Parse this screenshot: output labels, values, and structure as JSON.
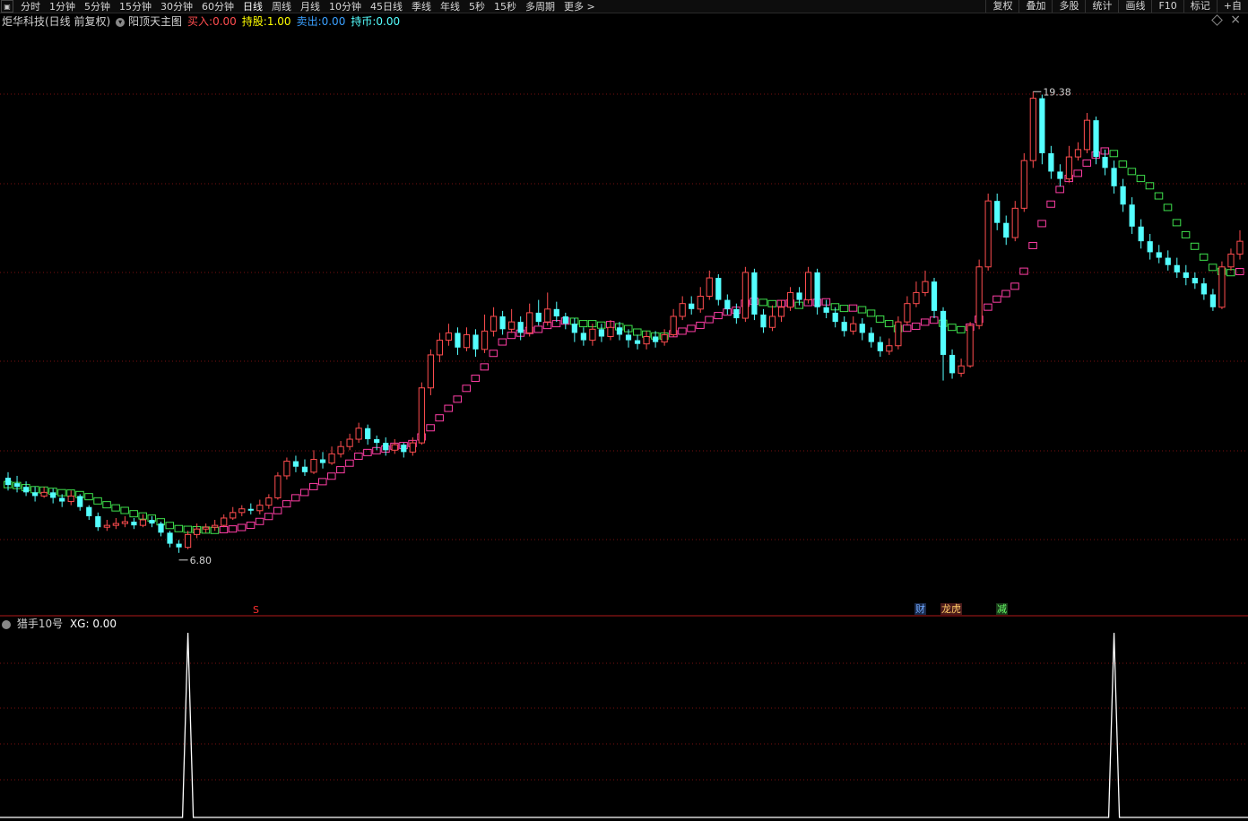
{
  "toolbar": {
    "periods": [
      "分时",
      "1分钟",
      "5分钟",
      "15分钟",
      "30分钟",
      "60分钟",
      "日线",
      "周线",
      "月线",
      "10分钟",
      "45日线",
      "季线",
      "年线",
      "5秒",
      "15秒",
      "多周期",
      "更多 >"
    ],
    "active_period": "日线",
    "right_buttons": [
      "复权",
      "叠加",
      "多股",
      "统计",
      "画线",
      "F10",
      "标记",
      "+自"
    ]
  },
  "legend": {
    "stock": "炬华科技(日线 前复权)",
    "indicator": "阳顶天主图",
    "buy_label": "买入:",
    "buy_value": "0.00",
    "hold_label": "持股:",
    "hold_value": "1.00",
    "sell_label": "卖出:",
    "sell_value": "0.00",
    "cash_label": "持币:",
    "cash_value": "0.00"
  },
  "sub_legend": {
    "indicator": "猎手10号",
    "label": "XG:",
    "value": "0.00"
  },
  "markers": {
    "s": "S",
    "cai": "财",
    "longhu": "龙虎",
    "jian": "减"
  },
  "colors": {
    "up": "#ff4d4f",
    "down": "#54ffff",
    "ma_up": "#ff3ea5",
    "ma_down": "#3ee04c",
    "grid": "#7a1010",
    "xg_line": "#ffffff"
  },
  "chart_data": {
    "type": "candlestick",
    "price_high_label": "19.38",
    "price_low_label": "6.80",
    "ylim": [
      5.5,
      21.0
    ],
    "candles": [
      [
        8.85,
        8.65,
        9.0,
        8.5
      ],
      [
        8.7,
        8.6,
        8.9,
        8.45
      ],
      [
        8.6,
        8.45,
        8.75,
        8.35
      ],
      [
        8.45,
        8.35,
        8.6,
        8.2
      ],
      [
        8.35,
        8.45,
        8.6,
        8.3
      ],
      [
        8.45,
        8.3,
        8.55,
        8.15
      ],
      [
        8.3,
        8.2,
        8.4,
        8.05
      ],
      [
        8.2,
        8.35,
        8.5,
        8.1
      ],
      [
        8.35,
        8.05,
        8.4,
        7.95
      ],
      [
        8.05,
        7.8,
        8.1,
        7.7
      ],
      [
        7.8,
        7.5,
        7.9,
        7.4
      ],
      [
        7.5,
        7.55,
        7.7,
        7.4
      ],
      [
        7.55,
        7.6,
        7.75,
        7.45
      ],
      [
        7.6,
        7.65,
        7.8,
        7.5
      ],
      [
        7.65,
        7.55,
        7.75,
        7.45
      ],
      [
        7.55,
        7.7,
        7.85,
        7.5
      ],
      [
        7.7,
        7.6,
        7.8,
        7.5
      ],
      [
        7.6,
        7.35,
        7.65,
        7.25
      ],
      [
        7.35,
        7.05,
        7.4,
        6.95
      ],
      [
        7.05,
        6.95,
        7.15,
        6.8
      ],
      [
        6.95,
        7.3,
        7.4,
        6.9
      ],
      [
        7.3,
        7.45,
        7.6,
        7.2
      ],
      [
        7.45,
        7.5,
        7.6,
        7.35
      ],
      [
        7.5,
        7.55,
        7.7,
        7.4
      ],
      [
        7.55,
        7.75,
        7.85,
        7.5
      ],
      [
        7.75,
        7.9,
        8.05,
        7.7
      ],
      [
        7.9,
        8.0,
        8.1,
        7.8
      ],
      [
        8.0,
        7.95,
        8.15,
        7.85
      ],
      [
        7.95,
        8.1,
        8.25,
        7.85
      ],
      [
        8.1,
        8.3,
        8.4,
        8.0
      ],
      [
        8.3,
        8.9,
        9.0,
        8.25
      ],
      [
        8.9,
        9.3,
        9.4,
        8.8
      ],
      [
        9.3,
        9.15,
        9.45,
        9.0
      ],
      [
        9.15,
        9.0,
        9.35,
        8.9
      ],
      [
        9.0,
        9.35,
        9.6,
        8.95
      ],
      [
        9.35,
        9.25,
        9.55,
        9.1
      ],
      [
        9.25,
        9.5,
        9.7,
        9.2
      ],
      [
        9.5,
        9.7,
        9.85,
        9.4
      ],
      [
        9.7,
        9.9,
        10.05,
        9.6
      ],
      [
        9.9,
        10.2,
        10.35,
        9.8
      ],
      [
        10.2,
        9.9,
        10.3,
        9.75
      ],
      [
        9.9,
        9.8,
        10.0,
        9.6
      ],
      [
        9.8,
        9.6,
        9.95,
        9.45
      ],
      [
        9.6,
        9.75,
        9.9,
        9.5
      ],
      [
        9.75,
        9.55,
        9.8,
        9.4
      ],
      [
        9.55,
        9.8,
        9.95,
        9.45
      ],
      [
        9.8,
        11.3,
        11.45,
        9.75
      ],
      [
        11.3,
        12.2,
        12.35,
        11.1
      ],
      [
        12.2,
        12.6,
        12.8,
        12.0
      ],
      [
        12.6,
        12.8,
        13.05,
        12.45
      ],
      [
        12.8,
        12.4,
        12.95,
        12.2
      ],
      [
        12.4,
        12.75,
        12.95,
        12.3
      ],
      [
        12.75,
        12.35,
        12.9,
        12.15
      ],
      [
        12.35,
        12.85,
        13.3,
        12.25
      ],
      [
        12.85,
        13.25,
        13.5,
        12.7
      ],
      [
        13.25,
        12.9,
        13.4,
        12.75
      ],
      [
        12.9,
        13.1,
        13.45,
        12.8
      ],
      [
        13.1,
        12.8,
        13.25,
        12.6
      ],
      [
        12.8,
        13.35,
        13.6,
        12.7
      ],
      [
        13.35,
        13.1,
        13.7,
        13.0
      ],
      [
        13.1,
        13.45,
        13.9,
        13.0
      ],
      [
        13.45,
        13.25,
        13.65,
        13.1
      ],
      [
        13.25,
        13.05,
        13.35,
        12.9
      ],
      [
        13.05,
        12.8,
        13.2,
        12.55
      ],
      [
        12.8,
        12.6,
        12.95,
        12.45
      ],
      [
        12.6,
        12.9,
        13.05,
        12.45
      ],
      [
        12.9,
        12.7,
        13.05,
        12.55
      ],
      [
        12.7,
        12.95,
        13.15,
        12.6
      ],
      [
        12.95,
        12.75,
        13.1,
        12.6
      ],
      [
        12.75,
        12.6,
        12.9,
        12.4
      ],
      [
        12.6,
        12.5,
        12.75,
        12.35
      ],
      [
        12.5,
        12.7,
        12.85,
        12.35
      ],
      [
        12.7,
        12.55,
        12.85,
        12.4
      ],
      [
        12.55,
        12.75,
        12.9,
        12.45
      ],
      [
        12.75,
        13.25,
        13.45,
        12.7
      ],
      [
        13.25,
        13.6,
        13.8,
        13.15
      ],
      [
        13.6,
        13.45,
        13.8,
        13.3
      ],
      [
        13.45,
        13.8,
        14.05,
        13.35
      ],
      [
        13.8,
        14.3,
        14.5,
        13.7
      ],
      [
        14.3,
        13.7,
        14.4,
        13.55
      ],
      [
        13.7,
        13.45,
        13.85,
        13.3
      ],
      [
        13.45,
        13.2,
        13.6,
        13.05
      ],
      [
        13.2,
        14.45,
        14.6,
        13.1
      ],
      [
        14.45,
        13.3,
        14.55,
        13.15
      ],
      [
        13.3,
        12.95,
        13.45,
        12.8
      ],
      [
        12.95,
        13.25,
        13.55,
        12.85
      ],
      [
        13.25,
        13.5,
        13.7,
        13.1
      ],
      [
        13.5,
        13.9,
        14.05,
        13.4
      ],
      [
        13.9,
        13.7,
        14.05,
        13.55
      ],
      [
        13.7,
        14.45,
        14.6,
        13.6
      ],
      [
        14.45,
        13.5,
        14.55,
        13.3
      ],
      [
        13.5,
        13.35,
        13.7,
        13.2
      ],
      [
        13.35,
        13.1,
        13.5,
        12.95
      ],
      [
        13.1,
        12.85,
        13.25,
        12.7
      ],
      [
        12.85,
        13.05,
        13.25,
        12.75
      ],
      [
        13.05,
        12.8,
        13.2,
        12.6
      ],
      [
        12.8,
        12.55,
        12.95,
        12.4
      ],
      [
        12.55,
        12.3,
        12.7,
        12.15
      ],
      [
        12.3,
        12.45,
        12.65,
        12.2
      ],
      [
        12.45,
        13.1,
        13.25,
        12.35
      ],
      [
        13.1,
        13.6,
        13.8,
        13.0
      ],
      [
        13.6,
        13.9,
        14.2,
        13.5
      ],
      [
        13.9,
        14.2,
        14.5,
        13.8
      ],
      [
        14.2,
        13.4,
        14.3,
        13.2
      ],
      [
        13.4,
        12.2,
        13.5,
        11.5
      ],
      [
        12.2,
        11.7,
        12.35,
        11.55
      ],
      [
        11.7,
        11.9,
        12.1,
        11.6
      ],
      [
        11.9,
        13.0,
        13.1,
        11.85
      ],
      [
        13.0,
        14.6,
        14.8,
        12.9
      ],
      [
        14.6,
        16.4,
        16.6,
        14.5
      ],
      [
        16.4,
        15.8,
        16.6,
        15.6
      ],
      [
        15.8,
        15.4,
        16.0,
        15.2
      ],
      [
        15.4,
        16.2,
        16.4,
        15.3
      ],
      [
        16.2,
        17.5,
        17.7,
        16.1
      ],
      [
        17.5,
        19.2,
        19.38,
        17.3
      ],
      [
        19.2,
        17.7,
        19.3,
        17.4
      ],
      [
        17.7,
        17.2,
        17.9,
        17.0
      ],
      [
        17.2,
        17.0,
        17.4,
        16.8
      ],
      [
        17.0,
        17.6,
        17.9,
        16.9
      ],
      [
        17.6,
        17.8,
        18.0,
        17.5
      ],
      [
        17.8,
        18.6,
        18.8,
        17.7
      ],
      [
        18.6,
        17.6,
        18.7,
        17.4
      ],
      [
        17.6,
        17.3,
        17.8,
        17.1
      ],
      [
        17.3,
        16.8,
        17.5,
        16.6
      ],
      [
        16.8,
        16.3,
        17.0,
        16.1
      ],
      [
        16.3,
        15.7,
        16.5,
        15.5
      ],
      [
        15.7,
        15.3,
        15.9,
        15.1
      ],
      [
        15.3,
        15.0,
        15.5,
        14.8
      ],
      [
        15.0,
        14.85,
        15.2,
        14.7
      ],
      [
        14.85,
        14.65,
        15.05,
        14.5
      ],
      [
        14.65,
        14.45,
        14.85,
        14.3
      ],
      [
        14.45,
        14.3,
        14.65,
        14.1
      ],
      [
        14.3,
        14.15,
        14.45,
        14.0
      ],
      [
        14.15,
        13.85,
        14.3,
        13.7
      ],
      [
        13.85,
        13.5,
        14.0,
        13.4
      ],
      [
        13.5,
        14.6,
        14.75,
        13.45
      ],
      [
        14.6,
        14.95,
        15.1,
        14.5
      ],
      [
        14.95,
        15.3,
        15.6,
        14.8
      ]
    ],
    "xg_signal_indices": [
      20,
      123
    ]
  }
}
